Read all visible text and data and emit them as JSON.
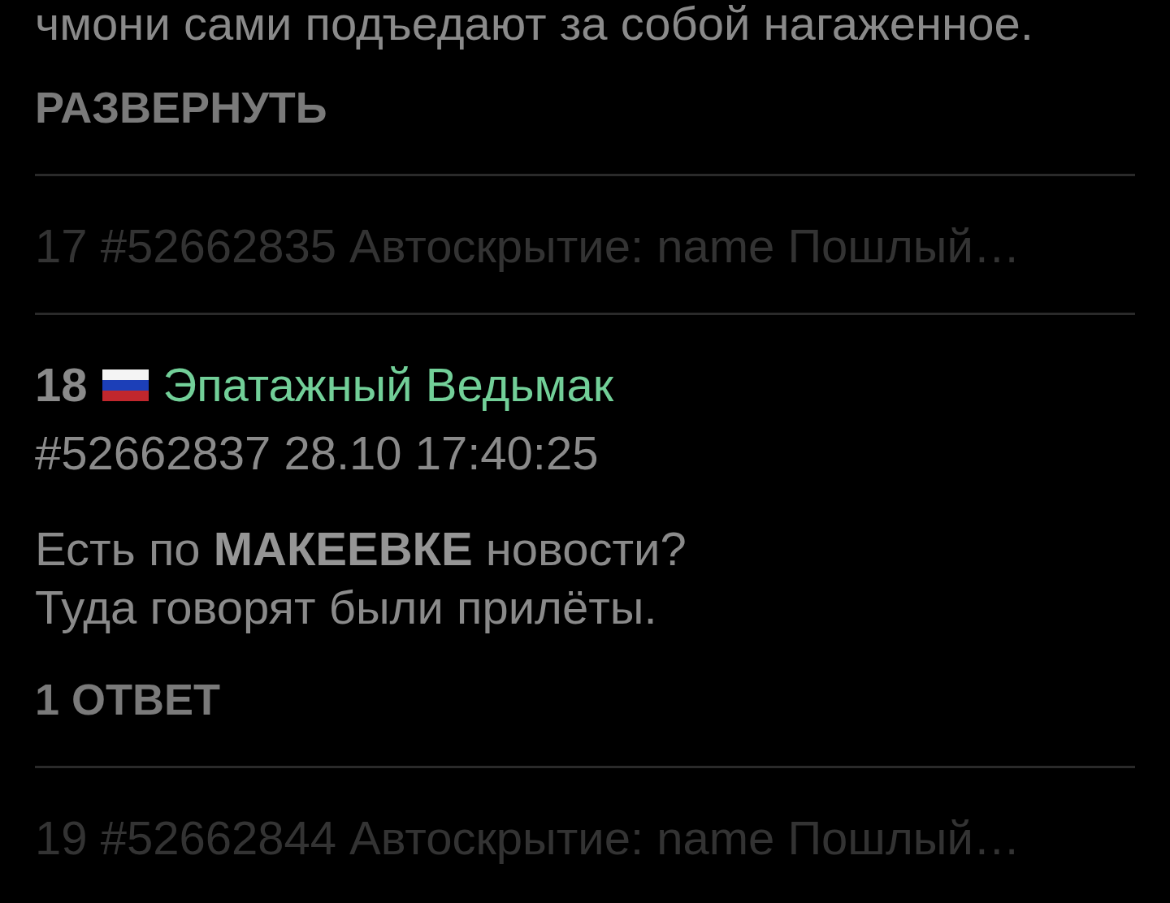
{
  "posts": [
    {
      "kind": "tail",
      "lines": [
        "чмони сами подъедают за собой нагаженное."
      ],
      "expand": "РАЗВЕРНУТЬ"
    },
    {
      "kind": "hidden",
      "text": "17 #52662835 Автоскрытие: name Пошлый…"
    },
    {
      "kind": "post",
      "number": "18",
      "name": "Эпатажный Ведьмак",
      "meta": "#52662837 28.10 17:40:25",
      "lines": [
        "Есть по **МАКЕЕВКЕ** новости?",
        "Туда говорят были прилёты."
      ],
      "replies": "1 ОТВЕТ"
    },
    {
      "kind": "hidden",
      "text": "19 #52662844 Автоскрытие: name Пошлый…"
    }
  ]
}
